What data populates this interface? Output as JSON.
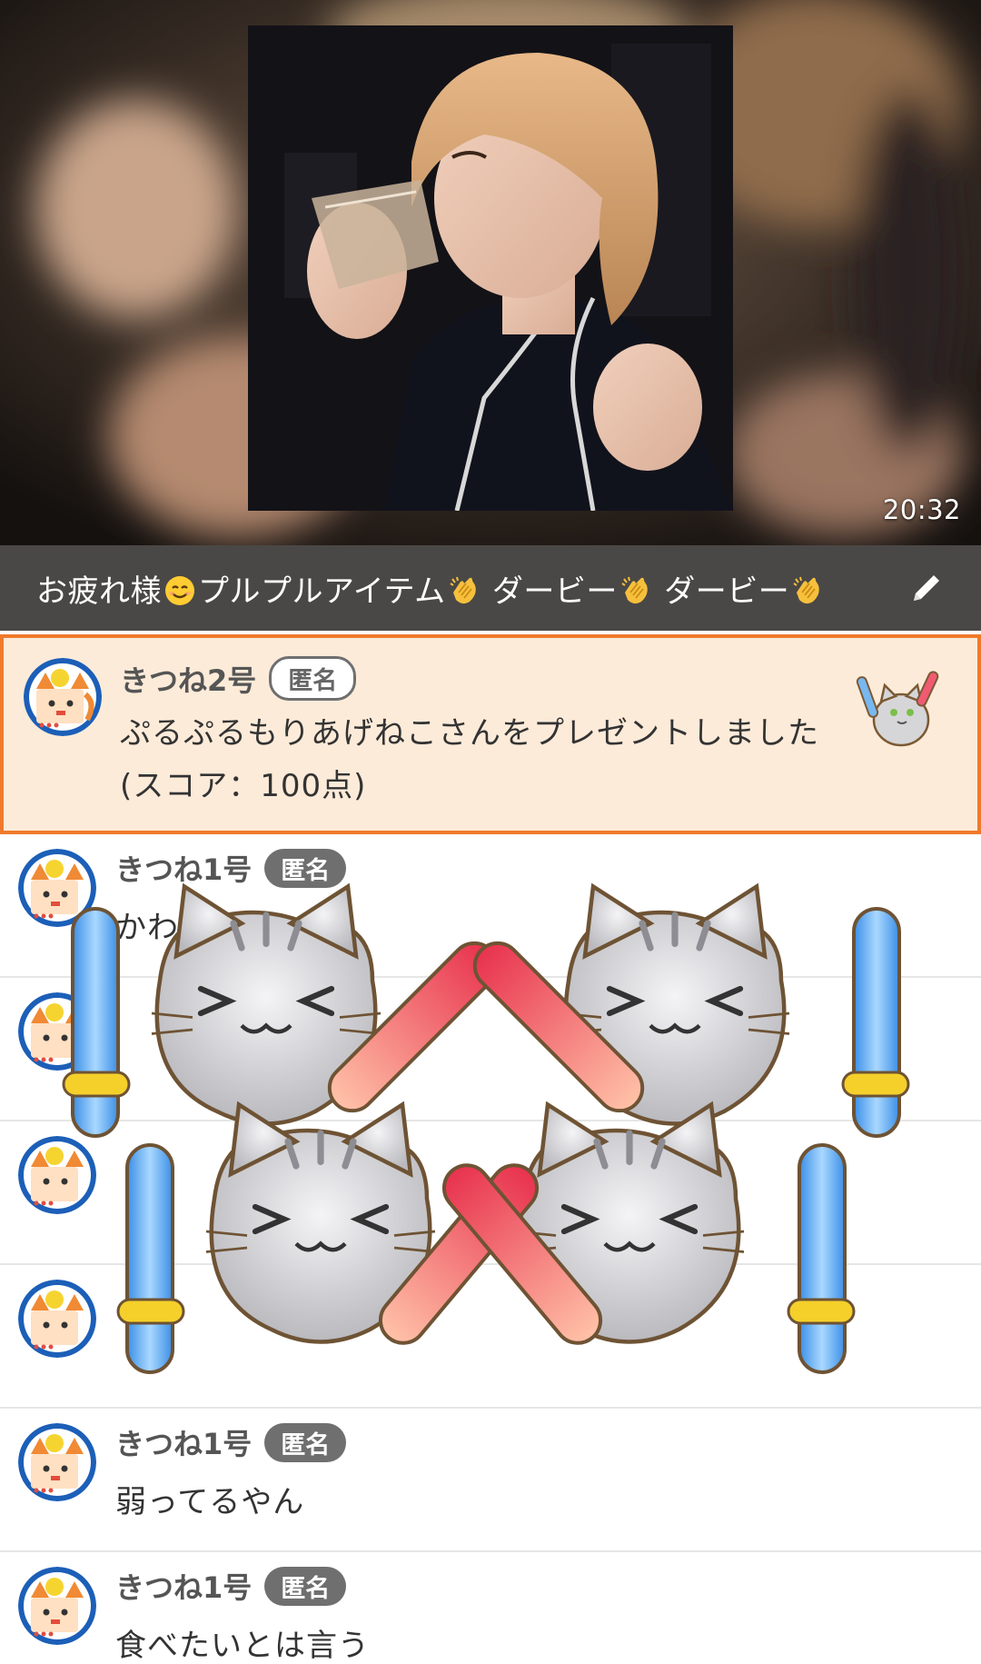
{
  "video": {
    "timestamp": "20:32"
  },
  "title_bar": {
    "text_parts": [
      "お疲れ様",
      "プルプルアイテム",
      " ダービー",
      " ダービー"
    ],
    "emoji_smile": "smiling-face-icon",
    "emoji_clap": "clapping-hands-icon",
    "edit_icon": "pencil-icon"
  },
  "comments": [
    {
      "user": "きつね2号",
      "badge": "匿名",
      "message": "ぷるぷるもりあげねこさんをプレゼントしました (スコア：100点)",
      "highlighted": true,
      "gift_icon": "penlight-cat-icon"
    },
    {
      "user": "きつね1号",
      "badge": "匿名",
      "message": "かわ…"
    },
    {
      "user": "",
      "badge": "",
      "message": ""
    },
    {
      "user": "",
      "badge": "",
      "message": ""
    },
    {
      "user": "",
      "badge": "",
      "message": ""
    },
    {
      "user": "きつね1号",
      "badge": "匿名",
      "message": "弱ってるやん"
    },
    {
      "user": "きつね1号",
      "badge": "匿名",
      "message": "食べたいとは言う"
    }
  ],
  "colors": {
    "title_bar_bg": "#4a4846",
    "highlight_bg": "#fdebd9",
    "highlight_border": "#f07a2b",
    "badge_bg": "#6f6f6f"
  }
}
